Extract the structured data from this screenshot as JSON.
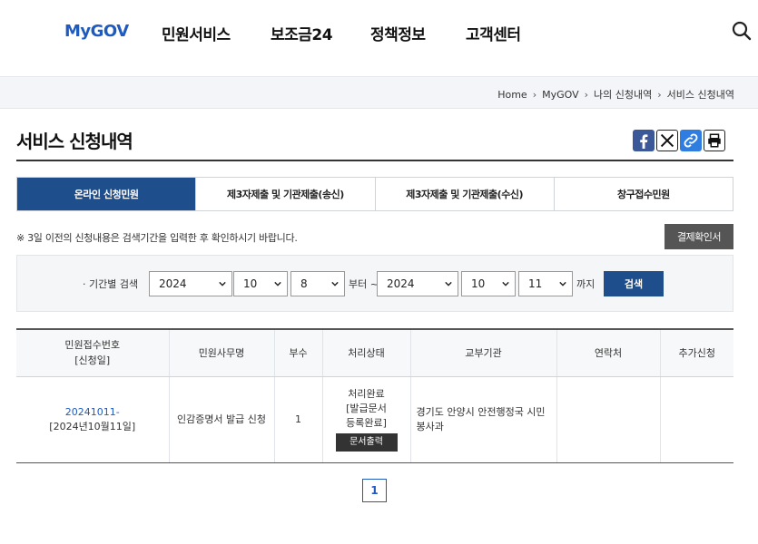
{
  "header": {
    "logo": "MyGOV",
    "menu": [
      "민원서비스",
      "보조금24",
      "정책정보",
      "고객센터"
    ]
  },
  "breadcrumb": [
    "Home",
    "MyGOV",
    "나의 신청내역",
    "서비스 신청내역"
  ],
  "page_title": "서비스 신청내역",
  "tabs": [
    {
      "label": "온라인 신청민원",
      "active": true
    },
    {
      "label": "제3자제출 및 기관제출(송신)",
      "active": false
    },
    {
      "label": "제3자제출 및 기관제출(수신)",
      "active": false
    },
    {
      "label": "창구접수민원",
      "active": false
    }
  ],
  "notice": "※ 3일 이전의 신청내용은 검색기간을 입력한 후 확인하시기 바랍니다.",
  "approve_button": "결제확인서",
  "search": {
    "label": "· 기간별 검색",
    "from": {
      "year": "2024",
      "month": "10",
      "day": "8"
    },
    "from_suffix": "부터 ~",
    "to": {
      "year": "2024",
      "month": "10",
      "day": "11"
    },
    "to_suffix": "까지",
    "button": "검색"
  },
  "table": {
    "headers": {
      "receipt_no": "민원접수번호",
      "receipt_date": "[신청일]",
      "service": "민원사무명",
      "copies": "부수",
      "status": "처리상태",
      "agency": "교부기관",
      "contact": "연락처",
      "extra": "추가신청"
    },
    "rows": [
      {
        "receipt_no": "20241011-",
        "receipt_date": "[2024년10월11일]",
        "service": "인감증명서 발급 신청",
        "copies": "1",
        "status_lines": [
          "처리완료",
          "[발급문서",
          "등록완료]"
        ],
        "doc_button": "문서출력",
        "agency": "경기도 안양시 안전행정국 시민봉사과",
        "contact": "",
        "extra": ""
      }
    ]
  },
  "pagination": {
    "current": "1"
  }
}
